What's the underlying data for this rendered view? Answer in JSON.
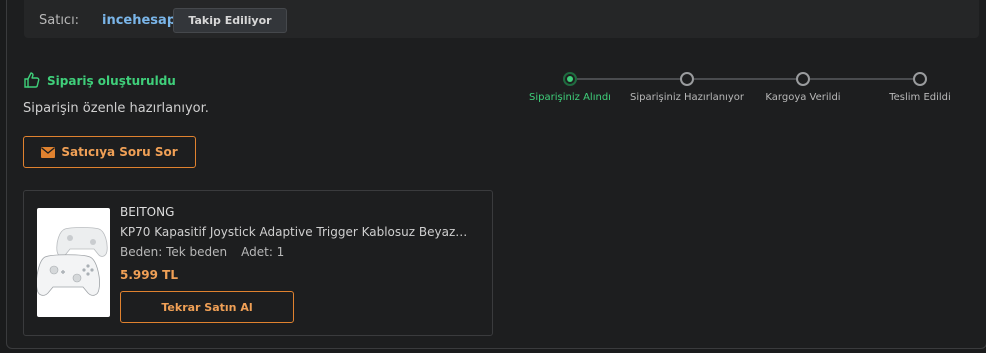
{
  "seller": {
    "label": "Satıcı:",
    "name": "incehesap",
    "follow_label": "Takip Ediliyor"
  },
  "status": {
    "title": "Sipariş oluşturuldu",
    "subtitle": "Siparişin özenle hazırlanıyor.",
    "ask_seller_label": "Satıcıya Soru Sor"
  },
  "tracker": {
    "steps": [
      {
        "label": "Siparişiniz Alındı",
        "active": true
      },
      {
        "label": "Siparişiniz Hazırlanıyor",
        "active": false
      },
      {
        "label": "Kargoya Verildi",
        "active": false
      },
      {
        "label": "Teslim Edildi",
        "active": false
      }
    ]
  },
  "product": {
    "brand": "BEITONG",
    "name": "KP70 Kapasitif Joystick Adaptive Trigger Kablosuz Beyaz…",
    "size": "Beden: Tek beden",
    "quantity": "Adet: 1",
    "price": "5.999 TL",
    "rebuy_label": "Tekrar Satın Al"
  },
  "colors": {
    "accent_orange": "#e0822f",
    "status_green": "#3fcf7a",
    "seller_link": "#7ab5e8"
  }
}
